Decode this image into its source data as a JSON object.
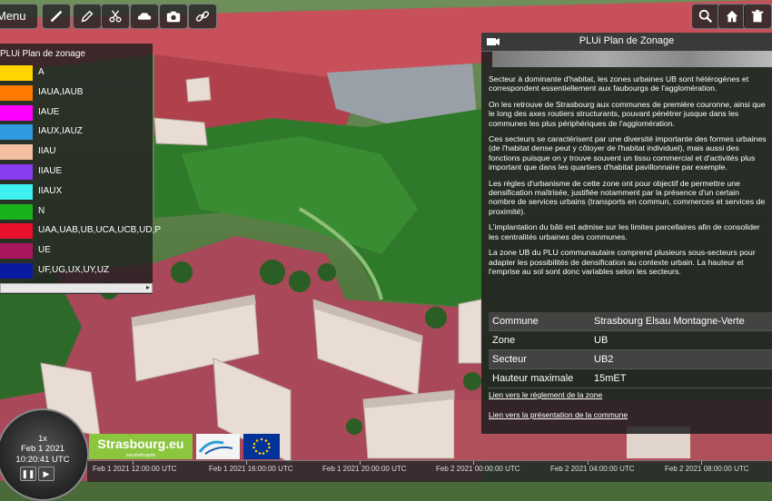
{
  "toolbar": {
    "menu_label": "Menu",
    "left_tools": [
      "ruler-icon",
      "pencil-icon",
      "scissors-icon",
      "cloud-icon",
      "camera-icon",
      "link-icon"
    ],
    "right_tools": [
      "search-icon",
      "home-icon",
      "trash-icon"
    ]
  },
  "legend": {
    "title": "PLUi Plan de zonage",
    "items": [
      {
        "label": "A",
        "color": "#ffd400"
      },
      {
        "label": "IAUA,IAUB",
        "color": "#ff7a00"
      },
      {
        "label": "IAUE",
        "color": "#ff00ff"
      },
      {
        "label": "IAUX,IAUZ",
        "color": "#2f9ae0"
      },
      {
        "label": "IIAU",
        "color": "#f5c0a0"
      },
      {
        "label": "IIAUE",
        "color": "#8a3cf0"
      },
      {
        "label": "IIAUX",
        "color": "#3ff0f0"
      },
      {
        "label": "N",
        "color": "#19b21e"
      },
      {
        "label": "UAA,UAB,UB,UCA,UCB,UD,P",
        "color": "#e8102a"
      },
      {
        "label": "UE",
        "color": "#a8175e"
      },
      {
        "label": "UF,UG,UX,UY,UZ",
        "color": "#0a1aa0"
      }
    ]
  },
  "info": {
    "title": "PLUi Plan de Zonage",
    "paragraphs": [
      "Secteur à dominante d'habitat, les zones urbaines UB sont hétérogènes et correspondent essentiellement aux faubourgs de l'agglomération.",
      "On les retrouve de Strasbourg aux communes de première couronne, ainsi que le long des axes routiers structurants, pouvant pénétrer jusque dans les communes les plus périphériques de l'agglomération.",
      "Ces secteurs se caractérisent par une diversité importante des formes urbaines (de l'habitat dense peut y côtoyer de l'habitat individuel), mais aussi des fonctions puisque on y trouve souvent un tissu commercial et d'activités plus important que dans les quartiers d'habitat pavillonnaire par exemple.",
      "Les règles d'urbanisme de cette zone ont pour objectif de permettre une densification maîtrisée, justifiée notamment par la présence d'un certain nombre de services urbains (transports en commun, commerces et services de proximité).",
      "L'implantation du bâti est admise sur les limites parcellaires afin de consolider les centralités urbaines des communes.",
      "La zone UB du PLU communautaire comprend plusieurs sous-secteurs pour adapter les possibilités de densification au contexte urbain. La hauteur et l'emprise au sol sont donc variables selon les secteurs."
    ],
    "attributes": [
      {
        "key": "Commune",
        "value": "Strasbourg Elsau Montagne-Verte"
      },
      {
        "key": "Zone",
        "value": "UB"
      },
      {
        "key": "Secteur",
        "value": "UB2"
      },
      {
        "key": "Hauteur maximale",
        "value": "15mET"
      }
    ],
    "link_reglement": "Lien vers le règlement de la zone",
    "link_presentation": "Lien vers la présentation de la commune"
  },
  "clock": {
    "speed": "1x",
    "date": "Feb 1 2021",
    "time": "10:20:41 UTC"
  },
  "timeline": {
    "ticks": [
      "Feb 1 2021 12:00:00 UTC",
      "Feb 1 2021 16:00:00 UTC",
      "Feb 1 2021 20:00:00 UTC",
      "Feb 2 2021 00:00:00 UTC",
      "Feb 2 2021 04:00:00 UTC",
      "Feb 2 2021 08:00:00 UTC"
    ]
  },
  "logos": {
    "strasbourg": "Strasbourg.eu",
    "strasbourg_sub": "eurométropole"
  }
}
